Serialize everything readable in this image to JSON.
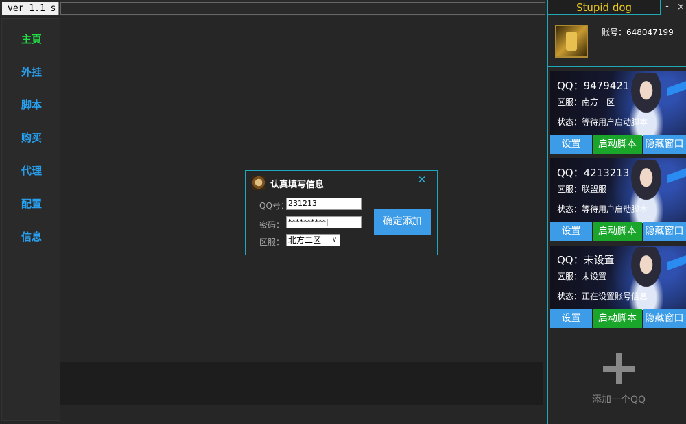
{
  "top_bar": {
    "version": "ver 1.1 s"
  },
  "sidebar": {
    "items": [
      {
        "label": "主頁",
        "active": true
      },
      {
        "label": "外挂"
      },
      {
        "label": "脚本"
      },
      {
        "label": "购买"
      },
      {
        "label": "代理"
      },
      {
        "label": "配置"
      },
      {
        "label": "信息"
      }
    ]
  },
  "dialog": {
    "title": "认真填写信息",
    "close_icon": "close-icon",
    "qq_label": "QQ号：",
    "qq_value": "231213",
    "password_label": "密码：",
    "password_value": "**********|",
    "zone_label": "区服：",
    "zone_value": "北方二区",
    "confirm_label": "确定添加"
  },
  "right_panel": {
    "title": "Stupid dog",
    "minimize": "-",
    "close": "×",
    "account": "账号：648047199",
    "accounts": [
      {
        "qq": "QQ：9479421",
        "zone": "区服：南方一区",
        "status": "状态：等待用户启动脚本"
      },
      {
        "qq": "QQ：4213213",
        "zone": "区服：联盟服",
        "status": "状态：等待用户启动脚本"
      },
      {
        "qq": "QQ：未设置",
        "zone": "区服：未设置",
        "status": "状态：正在设置账号信息"
      }
    ],
    "buttons": {
      "settings": "设置",
      "start": "启动脚本",
      "hide": "隐藏窗口"
    },
    "add_label": "添加一个QQ"
  },
  "colors": {
    "accent": "#1ea8b8",
    "nav": "#28a0f0",
    "nav_active": "#22dd44",
    "button_blue": "#3c9ce8",
    "button_green": "#1aa62a",
    "title_yellow": "#e8c820"
  }
}
